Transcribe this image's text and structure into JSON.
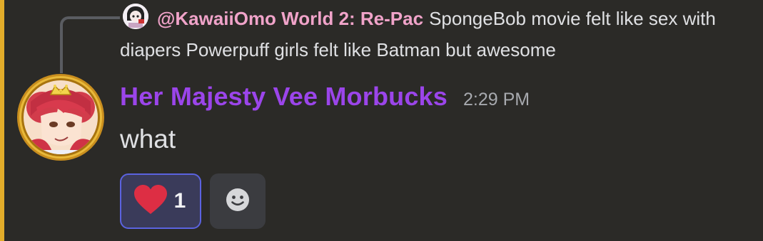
{
  "reply": {
    "author": "@KawaiiOmo World 2: Re-Pac",
    "text": "SpongeBob movie felt like sex with diapers   Powerpuff girls felt like Batman but awesome"
  },
  "message": {
    "author": "Her Majesty Vee Morbucks",
    "timestamp": "2:29 PM",
    "content": "what"
  },
  "reactions": [
    {
      "emoji": "heart-icon",
      "count": "1",
      "selected": true
    }
  ],
  "add_reaction_icon": "smiley-icon",
  "colors": {
    "background": "#2b2a27",
    "accent_bar": "#e2ac2a",
    "username": "#9b45ea",
    "reply_author": "#f0a3c9",
    "reaction_border": "#5b63e0"
  }
}
